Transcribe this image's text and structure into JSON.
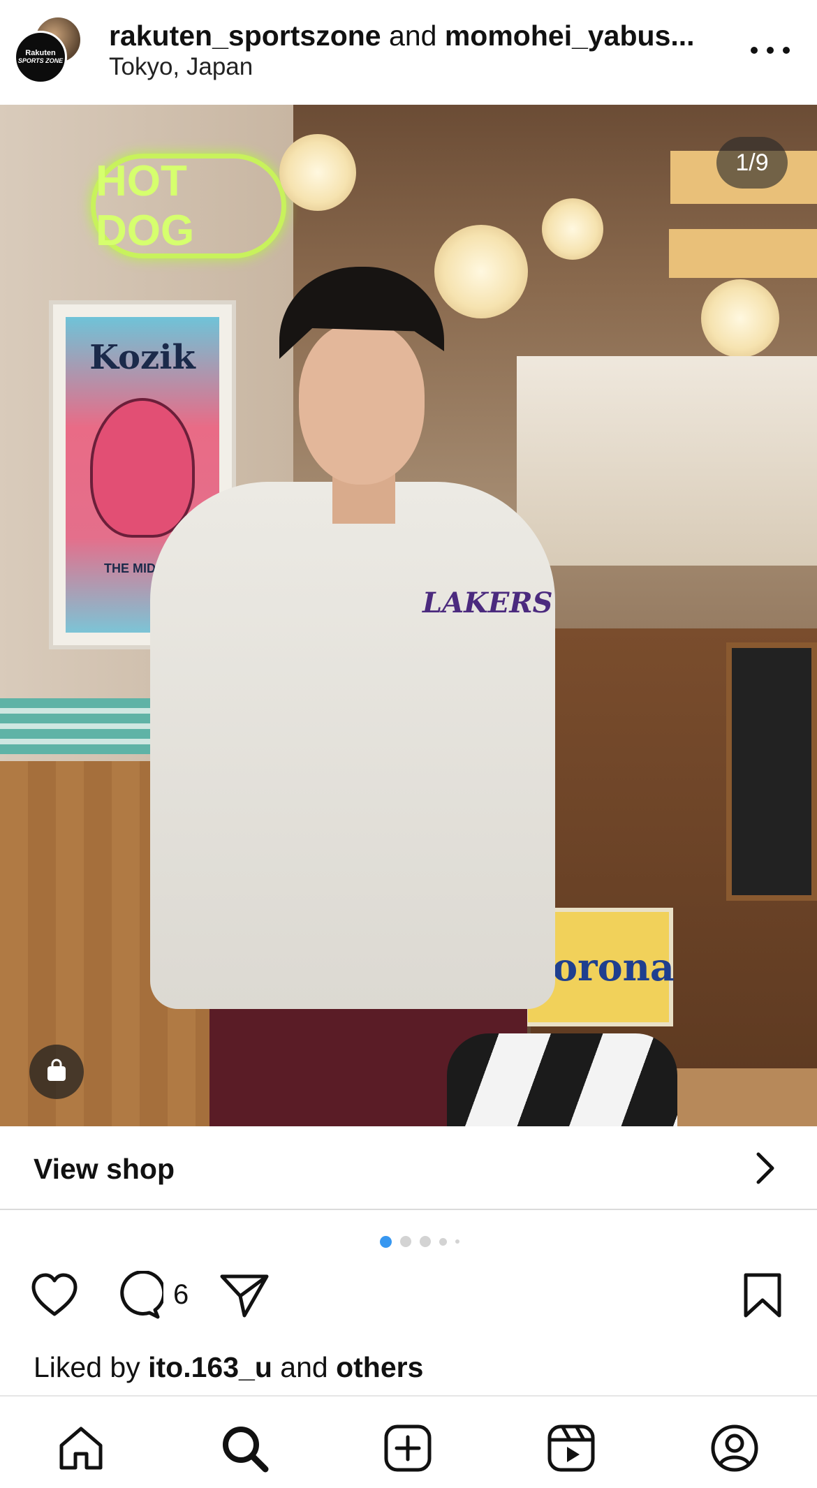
{
  "post_header": {
    "account_1": "rakuten_sportszone",
    "joiner": "and",
    "account_2": "momohei_yabus...",
    "location": "Tokyo, Japan",
    "avatar_text_line1": "Rakuten",
    "avatar_text_line2": "SPORTS ZONE",
    "more_icon": "more-horizontal-icon"
  },
  "photo": {
    "counter": "1/9",
    "shop_tag_icon": "shopping-bag-icon",
    "neon_text": "HOT DOG",
    "poster_title": "Kozik",
    "poster_footer": "THE MIDDLE",
    "sign_text": "Corona",
    "sweater_logo": "LAKERS",
    "colors": {
      "bag_bg": "#1e1e1e",
      "counter_bg": "#282828"
    }
  },
  "view_shop": {
    "label": "View shop",
    "icon": "chevron-right-icon"
  },
  "carousel": {
    "count": 5,
    "active": 0,
    "active_color": "#3797f0"
  },
  "actions": {
    "like_icon": "heart-icon",
    "comment_icon": "comment-icon",
    "comment_count": "6",
    "share_icon": "send-icon",
    "save_icon": "bookmark-icon"
  },
  "likes": {
    "prefix": "Liked by",
    "user": "ito.163_u",
    "joiner": "and",
    "others": "others"
  },
  "nav": {
    "items": [
      {
        "name": "home",
        "icon": "home-icon"
      },
      {
        "name": "search",
        "icon": "search-icon",
        "active": true
      },
      {
        "name": "create",
        "icon": "plus-square-icon"
      },
      {
        "name": "reels",
        "icon": "reels-icon"
      },
      {
        "name": "profile",
        "icon": "profile-icon"
      }
    ]
  }
}
